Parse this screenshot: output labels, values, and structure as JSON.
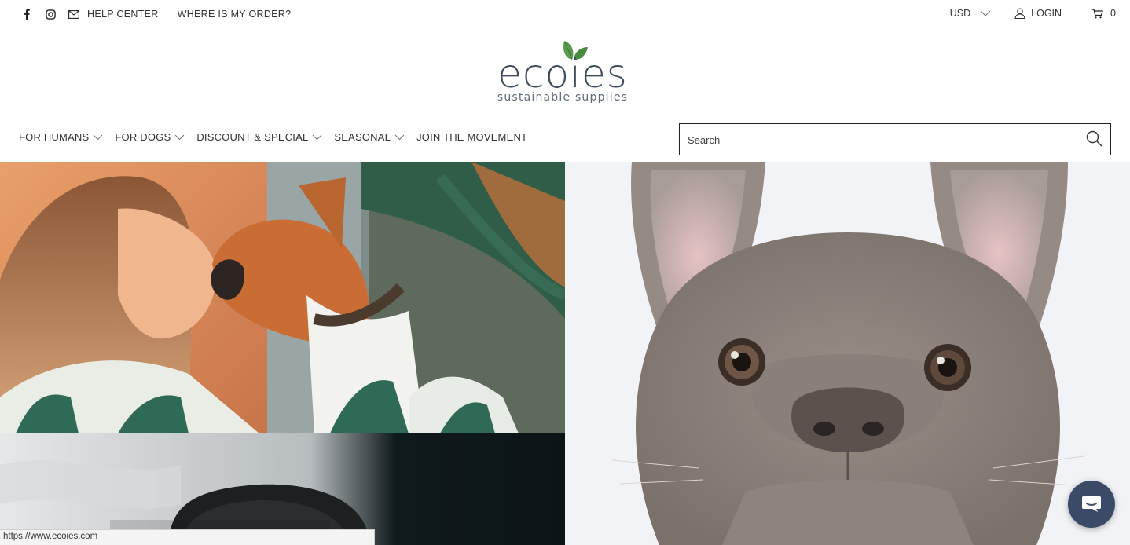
{
  "topbar": {
    "icons": [
      "facebook-icon",
      "instagram-icon",
      "mail-icon"
    ],
    "links": [
      "HELP CENTER",
      "WHERE IS MY ORDER?"
    ],
    "currency": "USD",
    "login": "LOGIN",
    "cart_count": "0"
  },
  "logo": {
    "wordmark": "ecoies",
    "tagline": "sustainable supplies",
    "leaf_color": "#5a9a4e"
  },
  "nav": {
    "items": [
      {
        "label": "FOR HUMANS",
        "dropdown": true
      },
      {
        "label": "FOR DOGS",
        "dropdown": true
      },
      {
        "label": "DISCOUNT & SPECIAL",
        "dropdown": true
      },
      {
        "label": "SEASONAL",
        "dropdown": true
      },
      {
        "label": "JOIN THE MOVEMENT",
        "dropdown": false
      }
    ]
  },
  "search": {
    "placeholder": "Search"
  },
  "colors": {
    "logo_text": "#3f4c5e",
    "chat_button": "#3b4a67"
  },
  "status_url": "https://www.ecoies.com"
}
